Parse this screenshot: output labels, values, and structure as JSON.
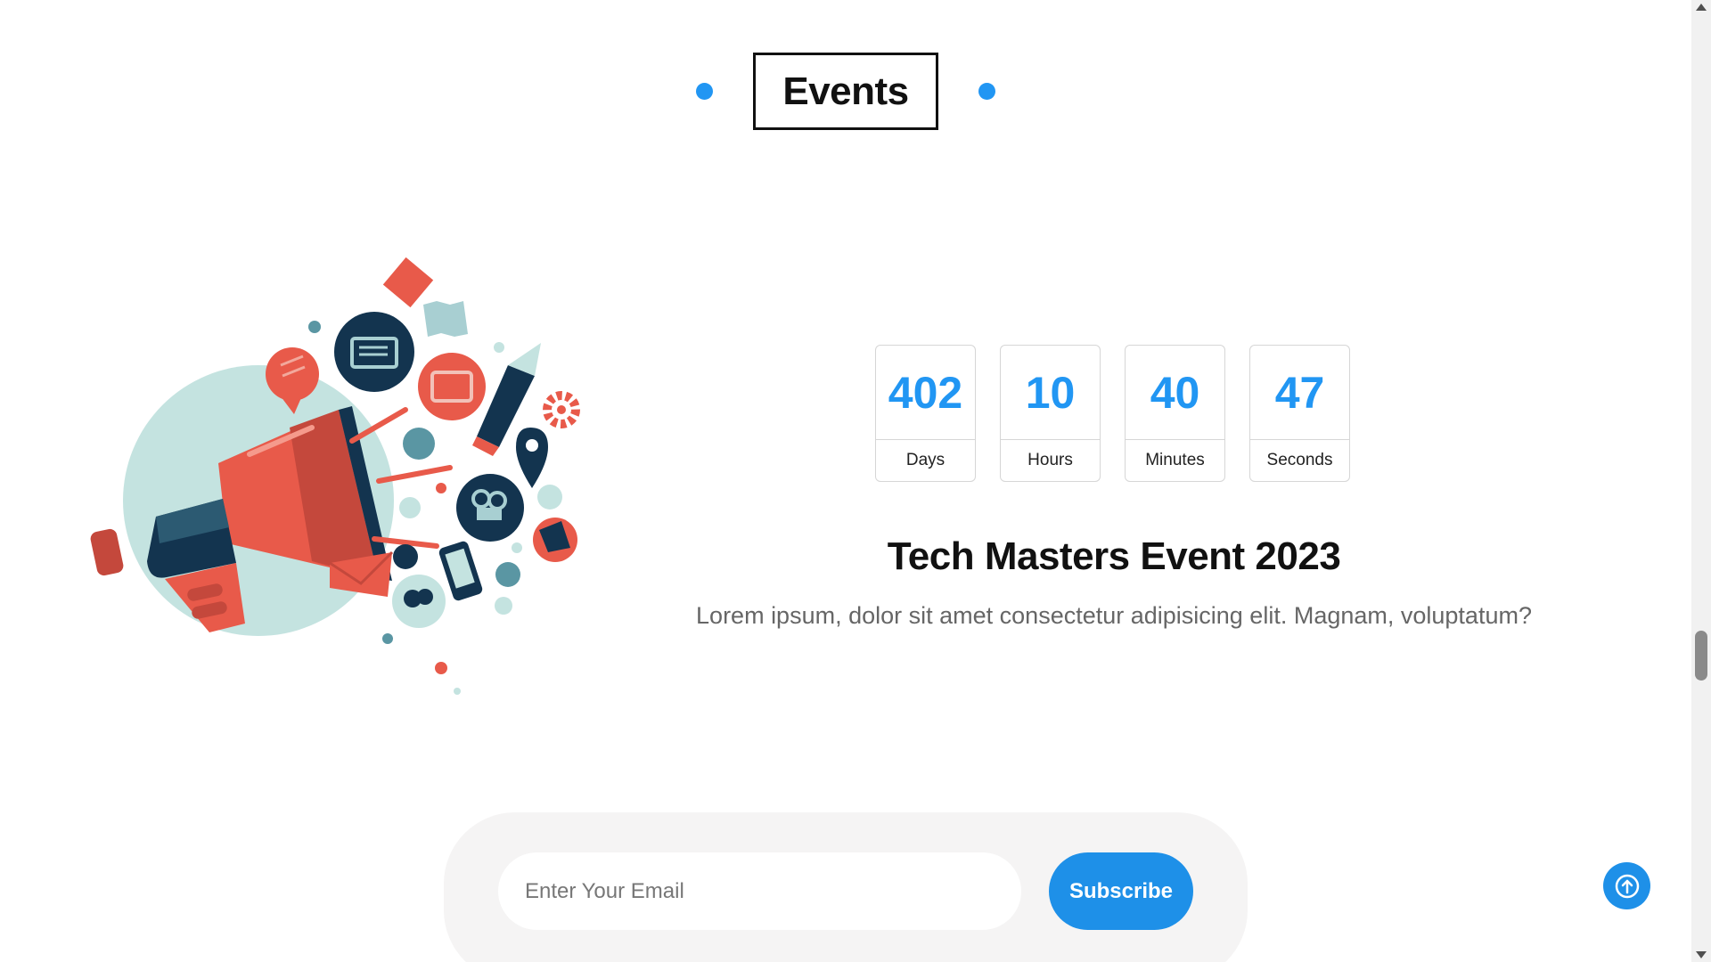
{
  "section": {
    "title": "Events"
  },
  "countdown": {
    "days": {
      "value": "402",
      "label": "Days"
    },
    "hours": {
      "value": "10",
      "label": "Hours"
    },
    "minutes": {
      "value": "40",
      "label": "Minutes"
    },
    "seconds": {
      "value": "47",
      "label": "Seconds"
    }
  },
  "event": {
    "title": "Tech Masters Event 2023",
    "description": "Lorem ipsum, dolor sit amet consectetur adipisicing elit. Magnam, voluptatum?"
  },
  "subscribe": {
    "email_placeholder": "Enter Your Email",
    "button_label": "Subscribe"
  },
  "colors": {
    "accent": "#2196f3",
    "megaphone_red": "#e85a4a",
    "navy": "#13344f",
    "mint": "#c4e3e0"
  },
  "icons": {
    "back_to_top": "arrow-up-icon",
    "illustration": "megaphone-illustration"
  }
}
